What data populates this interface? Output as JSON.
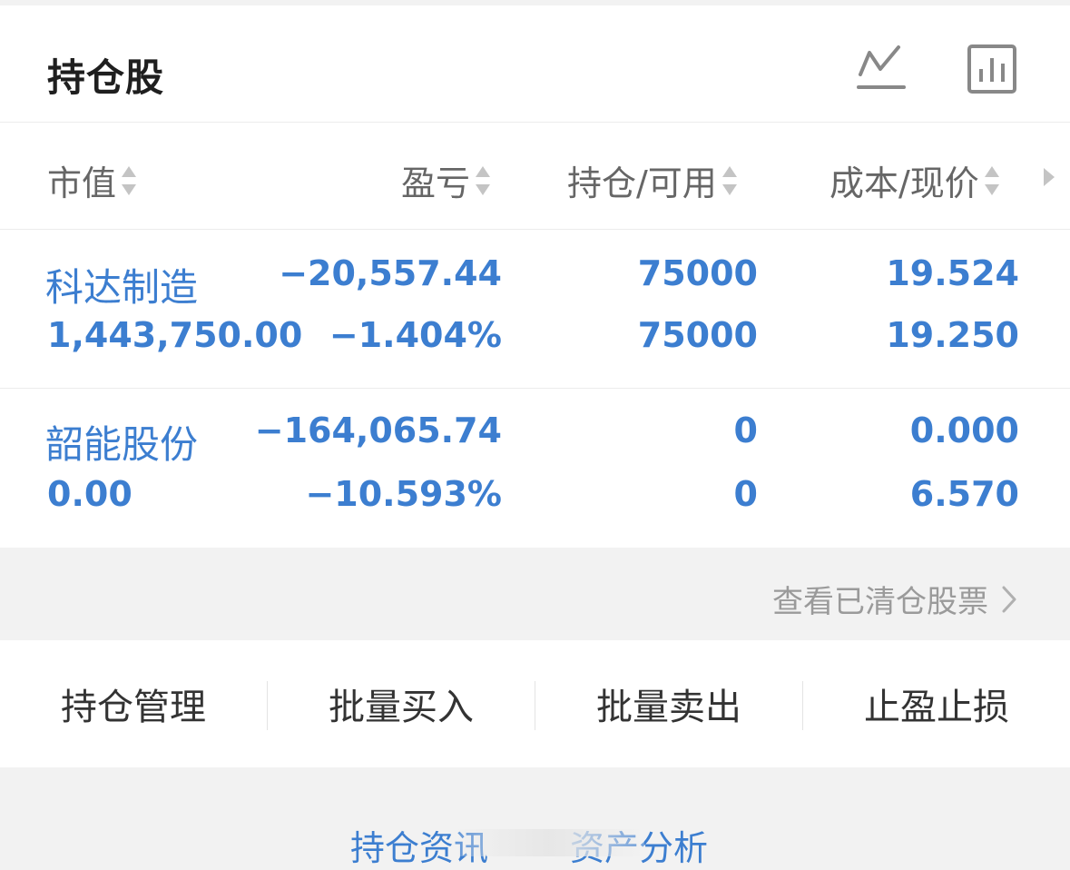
{
  "header": {
    "title": "持仓股",
    "icons": [
      "line-chart-icon",
      "bar-chart-icon"
    ]
  },
  "columns": [
    "市值",
    "盈亏",
    "持仓/可用",
    "成本/现价"
  ],
  "holdings": [
    {
      "name": "科达制造",
      "market_value": "1,443,750.00",
      "pnl": "−20,557.44",
      "pnl_pct": "−1.404%",
      "position": "75000",
      "available": "75000",
      "cost": "19.524",
      "price": "19.250"
    },
    {
      "name": "韶能股份",
      "market_value": "0.00",
      "pnl": "−164,065.74",
      "pnl_pct": "−10.593%",
      "position": "0",
      "available": "0",
      "cost": "0.000",
      "price": "6.570"
    }
  ],
  "view_cleared": "查看已清仓股票",
  "actions": [
    "持仓管理",
    "批量买入",
    "批量卖出",
    "止盈止损"
  ],
  "bottom_tabs": [
    "持仓资讯",
    "资产分析"
  ],
  "colors": {
    "accent": "#3c7ed0",
    "text_dark": "#1f1f1f",
    "text_gray": "#666666",
    "bg_gray": "#f2f2f2"
  }
}
